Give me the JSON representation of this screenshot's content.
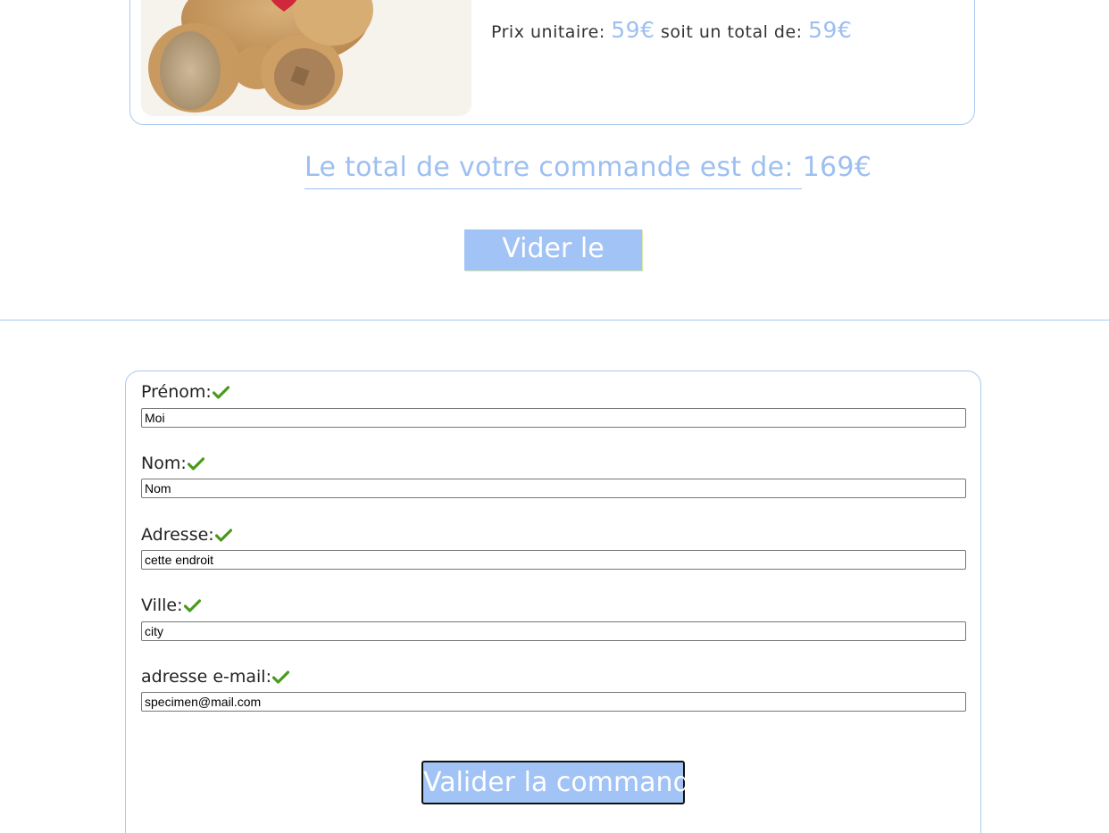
{
  "product": {
    "unit_price_label": "Prix unitaire:",
    "unit_price": "59€",
    "total_label": "soit un total de:",
    "total": "59€"
  },
  "order": {
    "total_label": "Le total de votre commande est de:",
    "total_value": "169€"
  },
  "cart": {
    "empty_button_label": "Vider le panier"
  },
  "form": {
    "fields": [
      {
        "label": "Prénom:",
        "value": "Moi"
      },
      {
        "label": "Nom:",
        "value": "Nom"
      },
      {
        "label": "Adresse:",
        "value": "cette endroit"
      },
      {
        "label": "Ville:",
        "value": "city"
      },
      {
        "label": "adresse e-mail:",
        "value": "specimen@mail.com"
      }
    ],
    "submit_label": "Valider la commande",
    "valid_icon": "checkmark-icon",
    "valid_color": "#4a9a1e"
  },
  "colors": {
    "accent": "#9dbff1",
    "button_bg": "#a2c3f5",
    "border": "#a8c9ef"
  }
}
